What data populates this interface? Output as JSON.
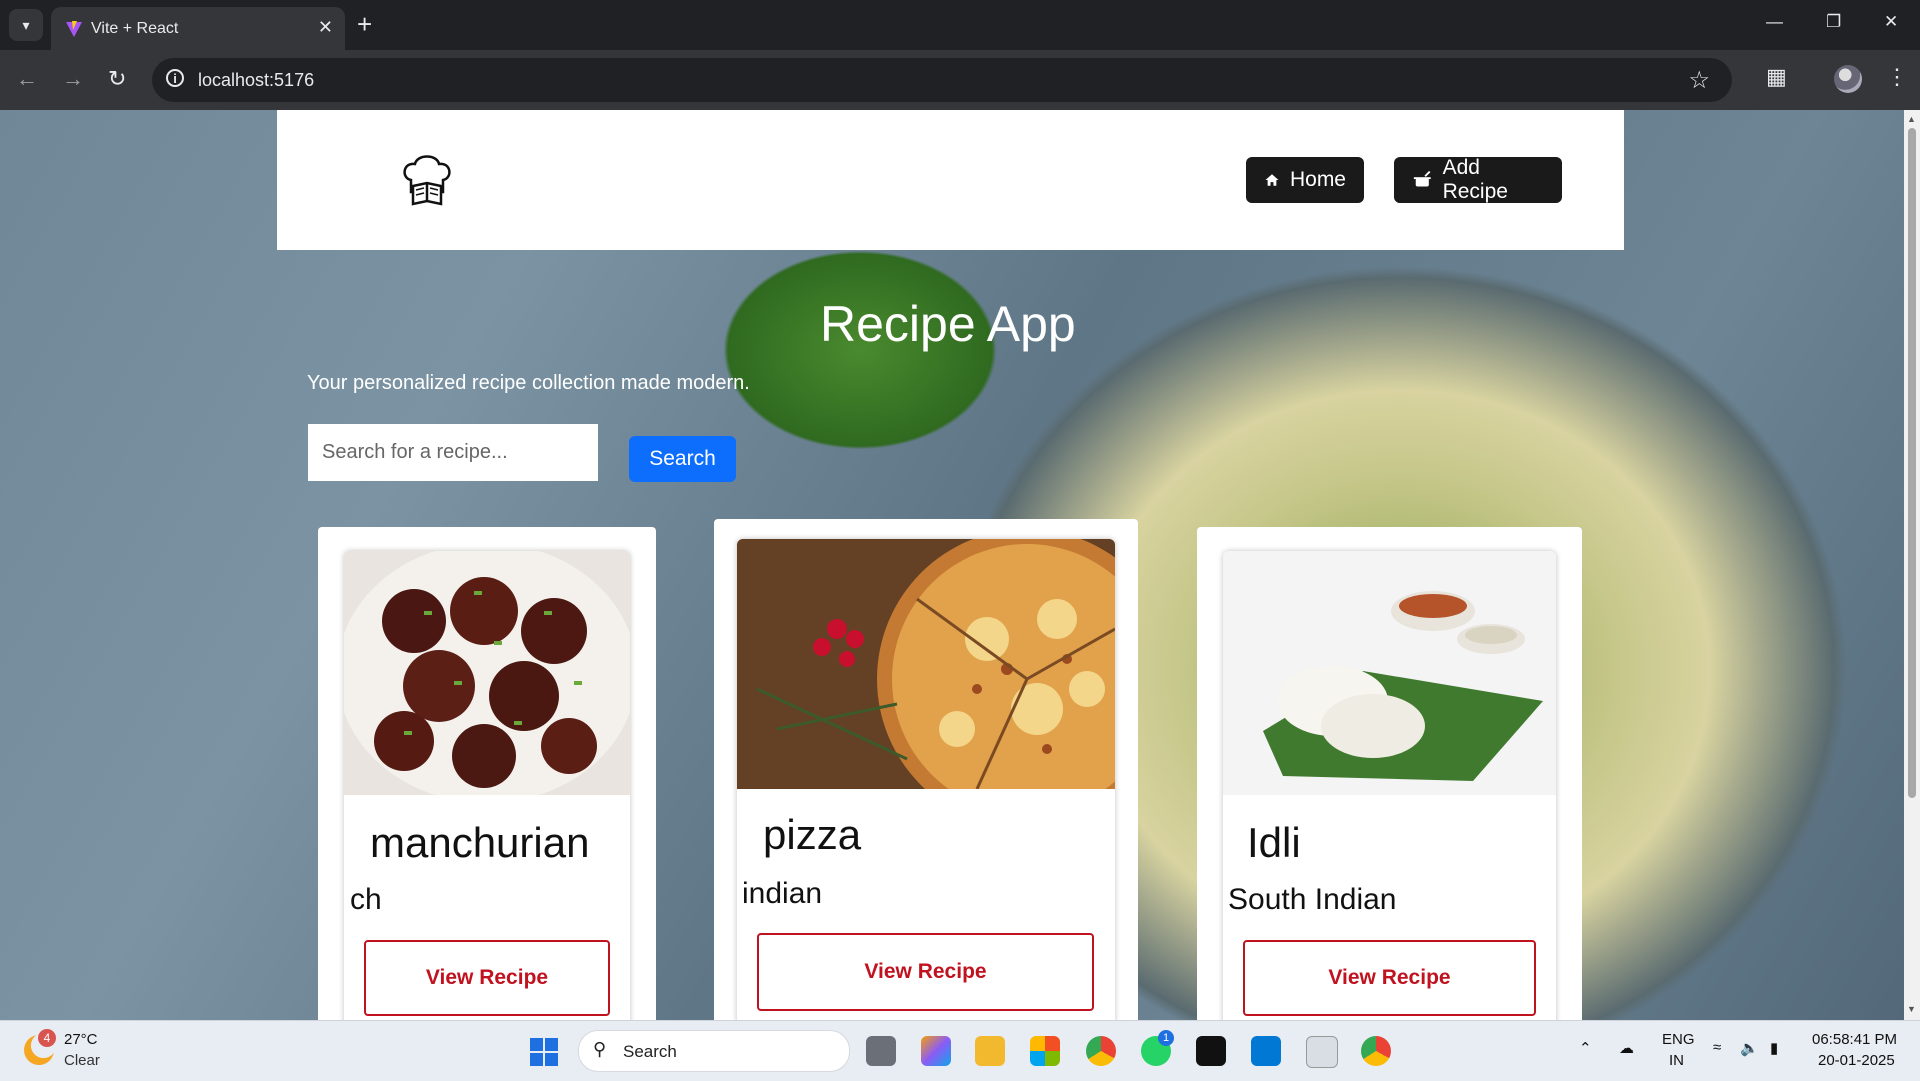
{
  "browser": {
    "tab_title": "Vite + React",
    "url": "localhost:5176"
  },
  "nav": {
    "home_label": "Home",
    "add_recipe_label": "Add Recipe"
  },
  "hero": {
    "title": "Recipe App",
    "tagline": "Your personalized recipe collection made modern.",
    "search_placeholder": "Search for a recipe...",
    "search_button": "Search"
  },
  "recipes": [
    {
      "name": "manchurian",
      "cuisine": "ch",
      "button": "View Recipe"
    },
    {
      "name": "pizza",
      "cuisine": "indian",
      "button": "View Recipe"
    },
    {
      "name": "Idli",
      "cuisine": "South Indian",
      "button": "View Recipe"
    }
  ],
  "taskbar": {
    "weather_temp": "27°C",
    "weather_condition": "Clear",
    "weather_badge": "4",
    "search_label": "Search",
    "language_top": "ENG",
    "language_bottom": "IN",
    "time": "06:58:41 PM",
    "date": "20-01-2025",
    "whatsapp_badge": "1"
  },
  "colors": {
    "primary": "#0d6efd",
    "view_button": "#c1121f",
    "nav_button": "#1a1a1a"
  }
}
